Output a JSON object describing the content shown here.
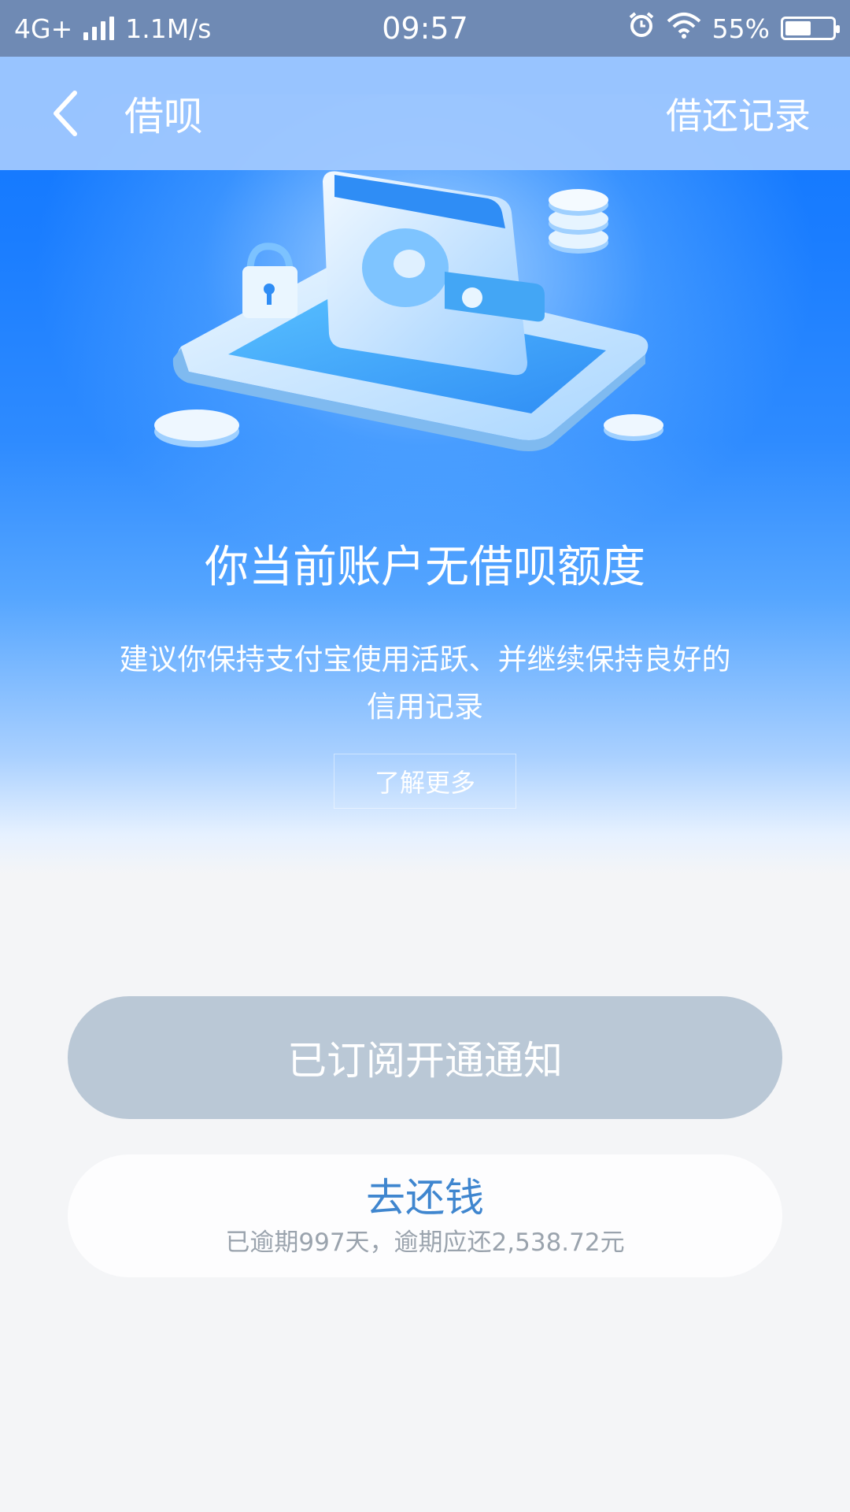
{
  "status_bar": {
    "network": "4G+",
    "speed": "1.1M/s",
    "time": "09:57",
    "battery_pct": "55%",
    "battery_level": 0.55
  },
  "nav": {
    "title": "借呗",
    "action_label": "借还记录"
  },
  "hero": {
    "headline": "你当前账户无借呗额度",
    "subtext": "建议你保持支付宝使用活跃、并继续保持良好的信用记录",
    "learn_more_label": "了解更多"
  },
  "actions": {
    "subscribed_label": "已订阅开通通知",
    "repay_label": "去还钱",
    "repay_detail": "已逾期997天，逾期应还2,538.72元"
  },
  "colors": {
    "accent_blue": "#1a7dff",
    "disabled_button": "#bac8d6",
    "repay_text": "#3f86cf"
  }
}
